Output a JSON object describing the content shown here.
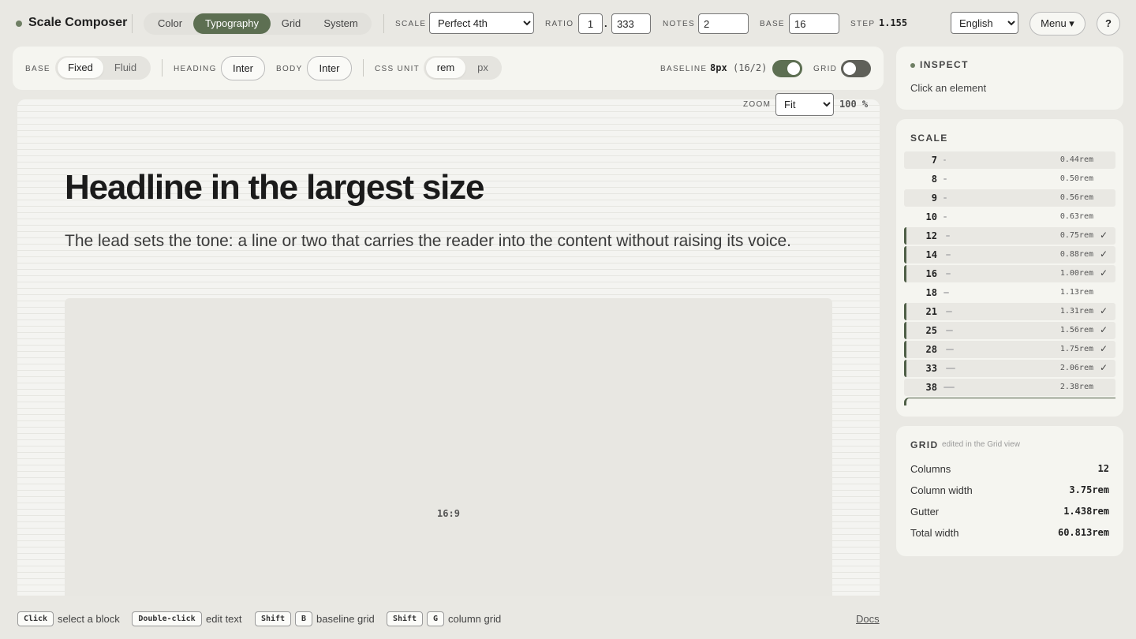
{
  "app": {
    "title": "Scale Composer"
  },
  "view_tabs": [
    "Color",
    "Typography",
    "Grid",
    "System"
  ],
  "active_view": "Typography",
  "scale": {
    "label": "SCALE",
    "value": "Perfect 4th",
    "options": [
      "Perfect 4th"
    ]
  },
  "ratio": {
    "label": "RATIO",
    "int": "1",
    "sep": ".",
    "frac": "333"
  },
  "notes": {
    "label": "NOTES",
    "value": "2"
  },
  "base": {
    "label": "BASE",
    "value": "16"
  },
  "step": {
    "label": "STEP",
    "value": "1.155"
  },
  "language": {
    "value": "English",
    "options": [
      "English"
    ]
  },
  "menu": {
    "label": "Menu ▾"
  },
  "help": {
    "label": "?"
  },
  "toolbar": {
    "base_label": "BASE",
    "base_options": [
      "Fixed",
      "Fluid"
    ],
    "base_active": "Fixed",
    "heading_label": "HEADING",
    "heading_font": "Inter",
    "body_label": "BODY",
    "body_font": "Inter",
    "unit_label": "CSS UNIT",
    "unit_options": [
      "rem",
      "px"
    ],
    "unit_active": "rem",
    "baseline_label": "BASELINE",
    "baseline_value": "8px",
    "baseline_note": "(16/2)",
    "baseline_on": true,
    "grid_label": "GRID",
    "grid_on": false
  },
  "canvas": {
    "zoom_label": "ZOOM",
    "zoom_value": "Fit",
    "zoom_options": [
      "Fit"
    ],
    "zoom_percent": "100 %",
    "headline": "Headline in the largest size",
    "lead": "The lead sets the tone: a line or two that carries the reader into the content without raising its voice.",
    "media_ratio": "16:9"
  },
  "inspect": {
    "title": "INSPECT",
    "hint": "Click an element"
  },
  "scale_panel": {
    "title": "SCALE",
    "rows": [
      {
        "px": "7",
        "rem": "0.44rem",
        "used": false
      },
      {
        "px": "8",
        "rem": "0.50rem",
        "used": false
      },
      {
        "px": "9",
        "rem": "0.56rem",
        "used": false
      },
      {
        "px": "10",
        "rem": "0.63rem",
        "used": false
      },
      {
        "px": "12",
        "rem": "0.75rem",
        "used": true
      },
      {
        "px": "14",
        "rem": "0.88rem",
        "used": true
      },
      {
        "px": "16",
        "rem": "1.00rem",
        "used": true
      },
      {
        "px": "18",
        "rem": "1.13rem",
        "used": false
      },
      {
        "px": "21",
        "rem": "1.31rem",
        "used": true
      },
      {
        "px": "25",
        "rem": "1.56rem",
        "used": true
      },
      {
        "px": "28",
        "rem": "1.75rem",
        "used": true
      },
      {
        "px": "33",
        "rem": "2.06rem",
        "used": true
      },
      {
        "px": "38",
        "rem": "2.38rem",
        "used": false
      }
    ],
    "check": "✓"
  },
  "grid_panel": {
    "title": "GRID",
    "subtitle": "edited in the Grid view",
    "rows": [
      {
        "label": "Columns",
        "value": "12"
      },
      {
        "label": "Column width",
        "value": "3.75rem"
      },
      {
        "label": "Gutter",
        "value": "1.438rem"
      },
      {
        "label": "Total width",
        "value": "60.813rem"
      }
    ]
  },
  "footer": {
    "click_key": "Click",
    "click_text": "select a block",
    "dbl_key": "Double-click",
    "dbl_text": "edit text",
    "shift_key": "Shift",
    "b_key": "B",
    "b_text": "baseline grid",
    "g_key": "G",
    "g_text": "column grid",
    "docs": "Docs"
  },
  "colors": {
    "accent": "#5d6f52",
    "background": "#e9e8e3",
    "panel": "#f5f5f0"
  }
}
